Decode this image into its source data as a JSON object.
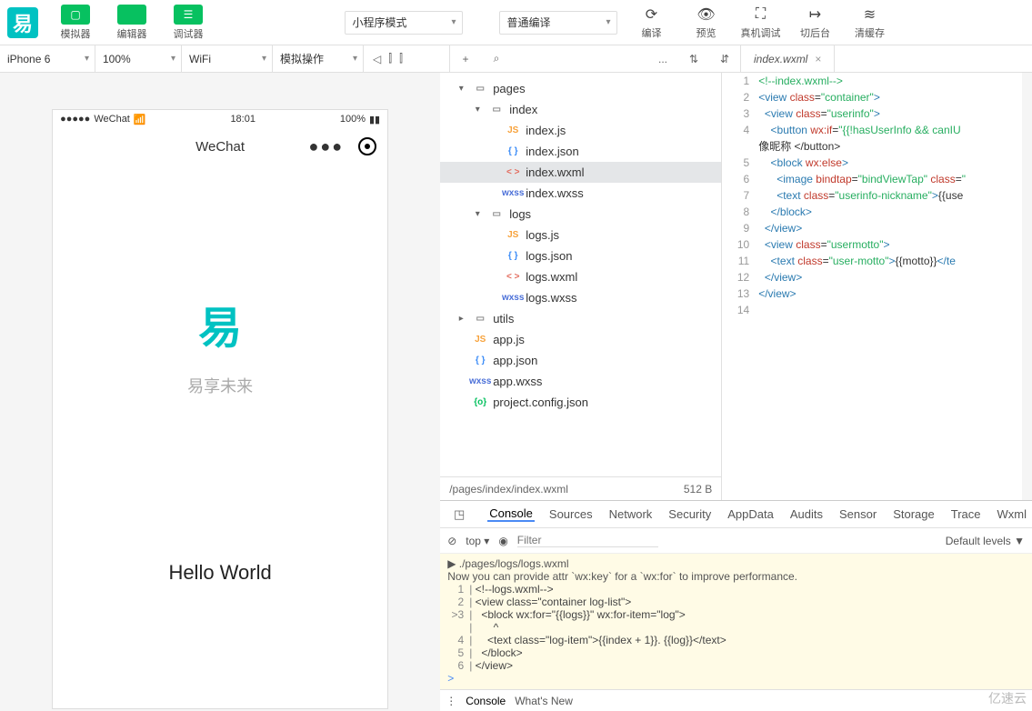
{
  "logo_text": "易",
  "top_tabs": [
    {
      "label": "模拟器",
      "icon": "▢"
    },
    {
      "label": "编辑器",
      "icon": "</>"
    },
    {
      "label": "调试器",
      "icon": "☰"
    }
  ],
  "program_mode": "小程序模式",
  "compile_mode": "普通编译",
  "top_actions": [
    {
      "label": "编译",
      "icon": "⟳"
    },
    {
      "label": "预览",
      "icon": "👁"
    },
    {
      "label": "真机调试",
      "icon": "⛶"
    },
    {
      "label": "切后台",
      "icon": "↦"
    },
    {
      "label": "清缓存",
      "icon": "≋"
    }
  ],
  "sub_bar": {
    "left": [
      {
        "label": "iPhone 6",
        "w": 105
      },
      {
        "label": "100%",
        "w": 95
      },
      {
        "label": "WiFi",
        "w": 100
      },
      {
        "label": "模拟操作",
        "w": 100
      }
    ],
    "icons_left": [
      "◁",
      "⫿",
      "⫿"
    ],
    "mid_icons": [
      "+",
      "⌕",
      "...",
      "⇅",
      "⇵"
    ]
  },
  "open_file": "index.wxml",
  "phone": {
    "carrier": "WeChat",
    "time": "18:01",
    "battery": "100%",
    "title": "WeChat",
    "app_name": "易",
    "app_sub": "易享未来",
    "greeting": "Hello World"
  },
  "tree": [
    {
      "d": 0,
      "exp": "▾",
      "type": "fold",
      "icon": "▭",
      "name": "pages"
    },
    {
      "d": 1,
      "exp": "▾",
      "type": "fold",
      "icon": "▭",
      "name": "index"
    },
    {
      "d": 2,
      "type": "js",
      "icon": "JS",
      "name": "index.js"
    },
    {
      "d": 2,
      "type": "json",
      "icon": "{ }",
      "name": "index.json"
    },
    {
      "d": 2,
      "type": "wxml",
      "icon": "< >",
      "name": "index.wxml",
      "sel": true
    },
    {
      "d": 2,
      "type": "wxss",
      "icon": "wxss",
      "name": "index.wxss"
    },
    {
      "d": 1,
      "exp": "▾",
      "type": "fold",
      "icon": "▭",
      "name": "logs"
    },
    {
      "d": 2,
      "type": "js",
      "icon": "JS",
      "name": "logs.js"
    },
    {
      "d": 2,
      "type": "json",
      "icon": "{ }",
      "name": "logs.json"
    },
    {
      "d": 2,
      "type": "wxml",
      "icon": "< >",
      "name": "logs.wxml"
    },
    {
      "d": 2,
      "type": "wxss",
      "icon": "wxss",
      "name": "logs.wxss"
    },
    {
      "d": 0,
      "exp": "▸",
      "type": "fold",
      "icon": "▭",
      "name": "utils"
    },
    {
      "d": 0,
      "type": "js",
      "icon": "JS",
      "name": "app.js"
    },
    {
      "d": 0,
      "type": "json",
      "icon": "{ }",
      "name": "app.json"
    },
    {
      "d": 0,
      "type": "wxss",
      "icon": "wxss",
      "name": "app.wxss"
    },
    {
      "d": 0,
      "type": "cfg",
      "icon": "{o}",
      "name": "project.config.json"
    }
  ],
  "status": {
    "path": "/pages/index/index.wxml",
    "size": "512 B"
  },
  "code": [
    {
      "n": 1,
      "html": "<span class='cmt'>&lt;!--index.wxml--&gt;</span>"
    },
    {
      "n": 2,
      "html": "<span class='tag'>&lt;view</span> <span class='attr'>class</span>=<span class='str'>\"container\"</span><span class='tag'>&gt;</span>"
    },
    {
      "n": 3,
      "html": "  <span class='tag'>&lt;view</span> <span class='attr'>class</span>=<span class='str'>\"userinfo\"</span><span class='tag'>&gt;</span>"
    },
    {
      "n": 4,
      "html": "    <span class='tag'>&lt;button</span> <span class='attr'>wx:if</span>=<span class='str'>\"{{!hasUserInfo &amp;&amp; canIU</span>"
    },
    {
      "n": "",
      "html": "<span class='txt'>像昵称 &lt;/button&gt;</span>"
    },
    {
      "n": 5,
      "html": "    <span class='tag'>&lt;block</span> <span class='attr'>wx:else</span><span class='tag'>&gt;</span>"
    },
    {
      "n": 6,
      "html": "      <span class='tag'>&lt;image</span> <span class='attr'>bindtap</span>=<span class='str'>\"bindViewTap\"</span> <span class='attr'>class</span>=<span class='str'>\"</span>"
    },
    {
      "n": 7,
      "html": "      <span class='tag'>&lt;text</span> <span class='attr'>class</span>=<span class='str'>\"userinfo-nickname\"</span><span class='tag'>&gt;</span>{{use"
    },
    {
      "n": 8,
      "html": "    <span class='tag'>&lt;/block&gt;</span>"
    },
    {
      "n": 9,
      "html": "  <span class='tag'>&lt;/view&gt;</span>"
    },
    {
      "n": 10,
      "html": "  <span class='tag'>&lt;view</span> <span class='attr'>class</span>=<span class='str'>\"usermotto\"</span><span class='tag'>&gt;</span>"
    },
    {
      "n": 11,
      "html": "    <span class='tag'>&lt;text</span> <span class='attr'>class</span>=<span class='str'>\"user-motto\"</span><span class='tag'>&gt;</span>{{motto}}<span class='tag'>&lt;/te</span>"
    },
    {
      "n": 12,
      "html": "  <span class='tag'>&lt;/view&gt;</span>"
    },
    {
      "n": 13,
      "html": "<span class='tag'>&lt;/view&gt;</span>"
    },
    {
      "n": 14,
      "html": ""
    }
  ],
  "dev": {
    "tabs": [
      "Console",
      "Sources",
      "Network",
      "Security",
      "AppData",
      "Audits",
      "Sensor",
      "Storage",
      "Trace",
      "Wxml"
    ],
    "active_tab": "Console",
    "context": "top",
    "filter_placeholder": "Filter",
    "levels": "Default levels ▼",
    "warn_file": "./pages/logs/logs.wxml",
    "warn_msg": "Now you can provide attr `wx:key` for a `wx:for` to improve performance.",
    "lines": [
      {
        "n": 1,
        "t": "<!--logs.wxml-->"
      },
      {
        "n": 2,
        "t": "<view class=\"container log-list\">"
      },
      {
        "n": 3,
        "t": "  <block wx:for=\"{{logs}}\" wx:for-item=\"log\">",
        "mark": ">"
      },
      {
        "n": "",
        "t": "      ^"
      },
      {
        "n": 4,
        "t": "    <text class=\"log-item\">{{index + 1}}. {{log}}</text>"
      },
      {
        "n": 5,
        "t": "  </block>"
      },
      {
        "n": 6,
        "t": "</view>"
      }
    ],
    "drawer": [
      "Console",
      "What's New"
    ]
  },
  "watermark": "亿速云"
}
